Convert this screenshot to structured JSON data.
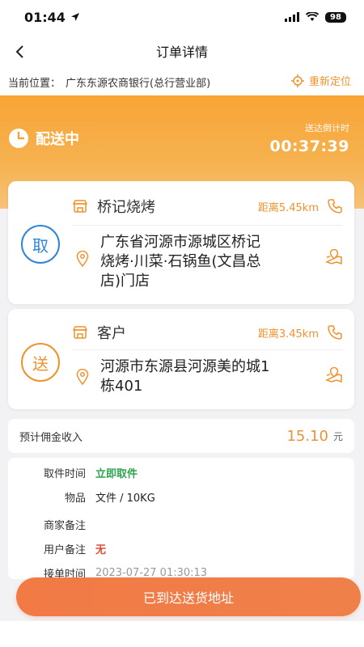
{
  "status_bar": {
    "time": "01:44",
    "battery": "98"
  },
  "nav": {
    "title": "订单详情"
  },
  "location": {
    "label": "当前位置：",
    "value": "广东东源农商银行(总行营业部)",
    "relocate_label": "重新定位"
  },
  "order_status": {
    "label": "配送中",
    "countdown_label": "送达倒计时",
    "countdown_value": "00:37:39"
  },
  "pickup": {
    "badge": "取",
    "name": "桥记烧烤",
    "distance": "距离5.45km",
    "address_line1": "广东省河源市源城区桥记",
    "address_line2": "烧烤·川菜·石锅鱼(文昌总",
    "address_line3": "店)门店"
  },
  "delivery": {
    "badge": "送",
    "name": "客户",
    "distance": "距离3.45km",
    "address_line1": "河源市东源县河源美的城1",
    "address_line2": "栋401"
  },
  "income": {
    "label": "预计佣金收入",
    "amount": "15.10",
    "unit": "元"
  },
  "details": {
    "pickup_time_label": "取件时间",
    "pickup_time_value": "立即取件",
    "goods_label": "物品",
    "goods_value": "文件 / 10KG",
    "merchant_note_label": "商家备注",
    "merchant_note_value": "",
    "user_note_label": "用户备注",
    "user_note_value": "无",
    "accept_time_label": "接单时间",
    "accept_time_value": "2023-07-27 01:30:13"
  },
  "action": {
    "label": "已到达送货地址"
  },
  "colors": {
    "accent": "#f0922c",
    "button": "#f17a45",
    "green": "#2ea44f",
    "red": "#e04b3a",
    "pickup_blue": "#2f86d8"
  }
}
